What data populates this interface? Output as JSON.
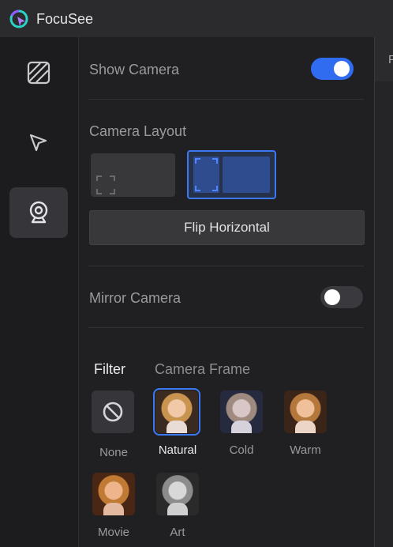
{
  "app": {
    "title": "FocuSee"
  },
  "right_panel": {
    "partial_label": "F"
  },
  "sidebar": {
    "items": [
      {
        "icon": "hatched-square-icon",
        "active": false
      },
      {
        "icon": "cursor-arrow-icon",
        "active": false
      },
      {
        "icon": "webcam-icon",
        "active": true
      }
    ]
  },
  "camera": {
    "show_camera_label": "Show Camera",
    "show_camera_on": true,
    "layout_label": "Camera Layout",
    "flip_button": "Flip Horizontal",
    "mirror_label": "Mirror Camera",
    "mirror_on": false
  },
  "tabs": [
    {
      "label": "Filter",
      "active": true
    },
    {
      "label": "Camera Frame",
      "active": false
    }
  ],
  "filters": [
    {
      "name": "None",
      "selected": false
    },
    {
      "name": "Natural",
      "selected": true
    },
    {
      "name": "Cold",
      "selected": false
    },
    {
      "name": "Warm",
      "selected": false
    },
    {
      "name": "Movie",
      "selected": false
    },
    {
      "name": "Art",
      "selected": false
    }
  ],
  "colors": {
    "accent": "#2f6cf0",
    "background": "#1f1f21",
    "text_dim": "#9a9a9e"
  }
}
